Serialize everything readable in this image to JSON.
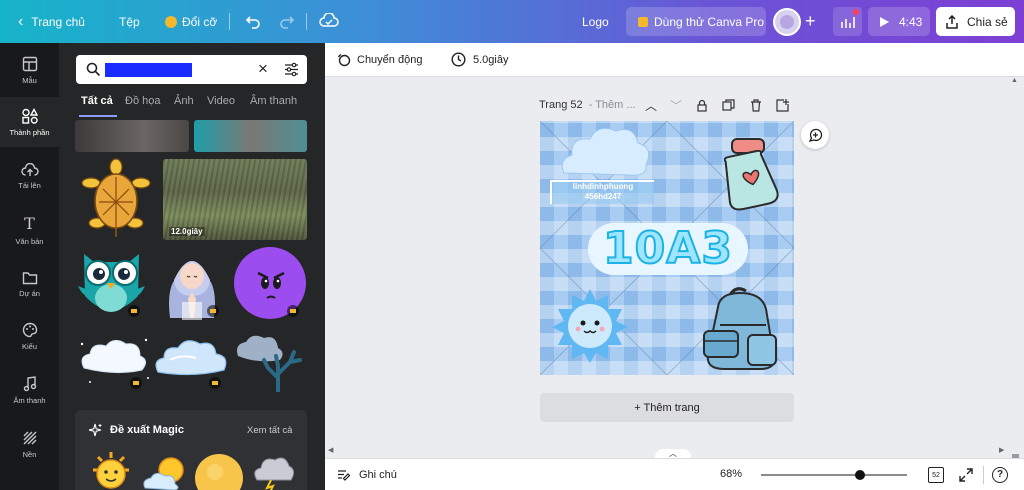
{
  "topbar": {
    "home": "Trang chủ",
    "file": "Tệp",
    "resize": "Đổi cỡ",
    "design_title": "Logo",
    "try_pro": "Dùng thử Canva Pro",
    "present_time": "4:43",
    "share": "Chia sẻ"
  },
  "rail": {
    "items": [
      {
        "label": "Mẫu"
      },
      {
        "label": "Thành phần"
      },
      {
        "label": "Tải lên"
      },
      {
        "label": "Văn bản"
      },
      {
        "label": "Dự án"
      },
      {
        "label": "Kiểu"
      },
      {
        "label": "Âm thanh"
      },
      {
        "label": "Nền"
      }
    ]
  },
  "panel": {
    "tabs": [
      "Tất cả",
      "Đồ họa",
      "Ảnh",
      "Video",
      "Âm thanh"
    ],
    "video_duration": "12.0giây",
    "magic_title": "Đề xuất Magic",
    "magic_see_all": "Xem tất cả"
  },
  "editor": {
    "animate": "Chuyển động",
    "duration": "5.0giây",
    "page_label": "Trang 52",
    "page_title_placeholder": "- Thêm ...",
    "canvas_text_line1": "linhdinhphuong",
    "canvas_text_line2": "456hd247",
    "canvas_headline": "10A3",
    "add_page": "+ Thêm trang",
    "notes": "Ghi chú",
    "zoom": "68%",
    "zoom_fraction": 0.68,
    "page_count": "52"
  },
  "colors": {
    "topbar_start": "#16b4c9",
    "topbar_end": "#7d3fd4",
    "panel_bg": "#252627",
    "rail_bg": "#18191b",
    "canvas_blue": "#9cc4ee",
    "owl_teal": "#1aa5a8",
    "purple": "#9b4df0"
  }
}
